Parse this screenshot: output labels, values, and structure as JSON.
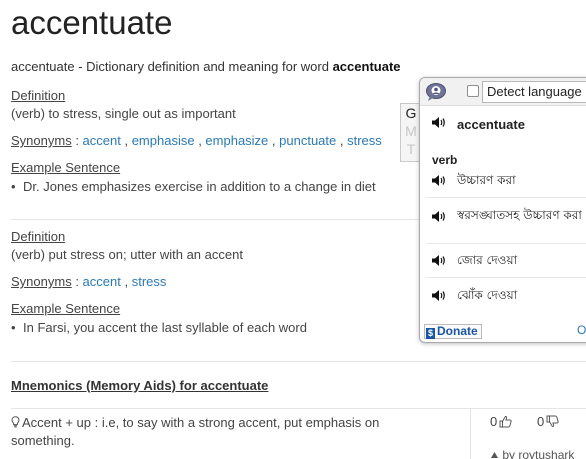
{
  "header": {
    "word": "accentuate",
    "subtitle_prefix": "accentuate - Dictionary definition and meaning for word ",
    "subtitle_word": "accentuate"
  },
  "senses": [
    {
      "definition_label": "Definition",
      "definition": "(verb) to stress, single out as important",
      "synonyms_label": "Synonyms",
      "synonyms": [
        "accent",
        "emphasise",
        "emphasize",
        "punctuate",
        "stress"
      ],
      "example_label": "Example Sentence",
      "examples": [
        "Dr. Jones emphasizes exercise in addition to a change in diet"
      ]
    },
    {
      "definition_label": "Definition",
      "definition": "(verb) put stress on; utter with an accent",
      "synonyms_label": "Synonyms",
      "synonyms": [
        "accent",
        "stress"
      ],
      "example_label": "Example Sentence",
      "examples": [
        "In Farsi, you accent the last syllable of each word"
      ]
    }
  ],
  "mnemonics": {
    "title": "Mnemonics (Memory Aids) for accentuate",
    "text": "Accent + up : i.e, to say with a strong accent, put emphasis on something.",
    "up_votes": "0",
    "down_votes": "0",
    "by_text": "by roytushark"
  },
  "translate_popup": {
    "tab_letters": [
      "G",
      "M",
      "T"
    ],
    "detect_language_label": "Detect language",
    "headword": "accentuate",
    "part_of_speech": "verb",
    "translations": [
      "উচ্চারণ করা",
      "স্বরসঙ্ঘাতসহ উচ্চারণ করা",
      "জোর দেওয়া",
      "ঝোঁক দেওয়া"
    ],
    "donate_label": "Donate",
    "options_link": "O"
  },
  "colors": {
    "link": "#2a7ab5",
    "text": "#444444",
    "donate": "#1a56a6"
  }
}
